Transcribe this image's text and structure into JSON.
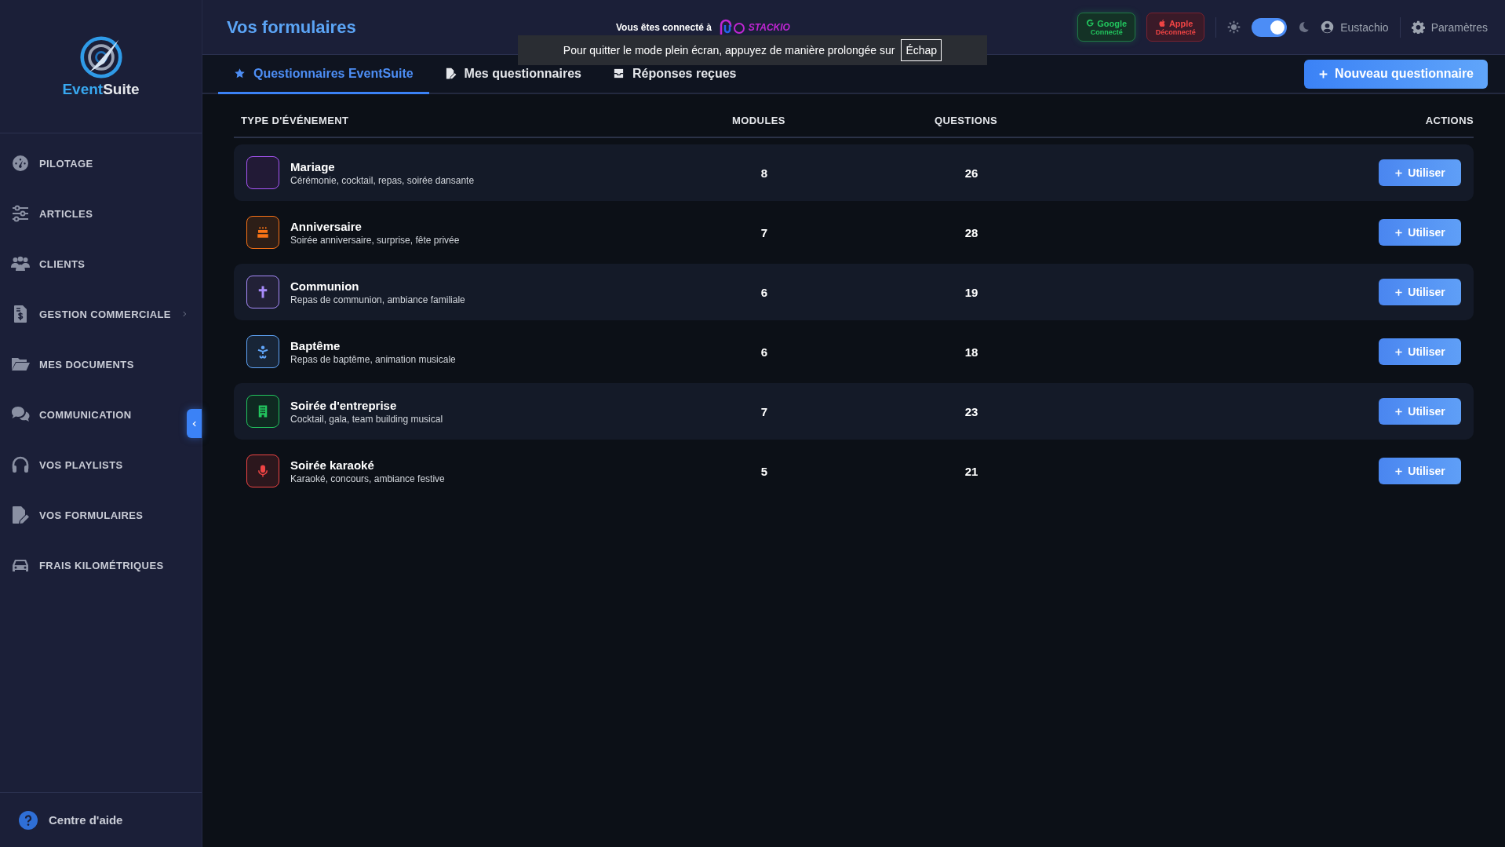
{
  "sidebar": {
    "logo": {
      "first": "Event",
      "second": "Suite"
    },
    "items": [
      {
        "label": "PILOTAGE",
        "kind": "link"
      },
      {
        "label": "ARTICLES",
        "kind": "link"
      },
      {
        "label": "CLIENTS",
        "kind": "link"
      },
      {
        "label": "GESTION COMMERCIALE",
        "kind": "group"
      },
      {
        "label": "MES DOCUMENTS",
        "kind": "link"
      },
      {
        "label": "COMMUNICATION",
        "kind": "link"
      },
      {
        "label": "VOS PLAYLISTS",
        "kind": "link"
      },
      {
        "label": "VOS FORMULAIRES",
        "kind": "link"
      },
      {
        "label": "FRAIS KILOMÉTRIQUES",
        "kind": "link"
      }
    ],
    "help": "Centre d'aide"
  },
  "header": {
    "title": "Vos formulaires",
    "connected_to": "Vous êtes connecté à",
    "partner": "STACKIO",
    "accounts": [
      {
        "name": "Google",
        "status": "Connecté",
        "connected": true
      },
      {
        "name": "Apple",
        "status": "Déconnecté",
        "connected": false
      }
    ],
    "dark_mode": {
      "on": true
    },
    "user": "Eustachio",
    "settings": "Paramètres"
  },
  "toast": {
    "text": "Pour quitter le mode plein écran, appuyez de manière prolongée sur",
    "key": "Échap"
  },
  "tabs": [
    {
      "label": "Questionnaires EventSuite",
      "selected": true
    },
    {
      "label": "Mes questionnaires",
      "selected": false
    },
    {
      "label": "Réponses reçues",
      "selected": false
    }
  ],
  "new_button": "Nouveau questionnaire",
  "table": {
    "columns": [
      "TYPE D'ÉVÉNEMENT",
      "MODULES",
      "QUESTIONS",
      "ACTIONS"
    ],
    "rows": [
      {
        "name": "Mariage",
        "description": "Cérémonie, cocktail, repas, soirée dansante",
        "modules": "8",
        "questions": "26",
        "action": "Utiliser",
        "color": "#a855f7"
      },
      {
        "name": "Anniversaire",
        "description": "Soirée anniversaire, surprise, fête privée",
        "modules": "7",
        "questions": "28",
        "action": "Utiliser",
        "color": "#f97316"
      },
      {
        "name": "Communion",
        "description": "Repas de communion, ambiance familiale",
        "modules": "6",
        "questions": "19",
        "action": "Utiliser",
        "color": "#a78bfa"
      },
      {
        "name": "Baptême",
        "description": "Repas de baptême, animation musicale",
        "modules": "6",
        "questions": "18",
        "action": "Utiliser",
        "color": "#60a5fa"
      },
      {
        "name": "Soirée d'entreprise",
        "description": "Cocktail, gala, team building musical",
        "modules": "7",
        "questions": "23",
        "action": "Utiliser",
        "color": "#22c55e"
      },
      {
        "name": "Soirée karaoké",
        "description": "Karaoké, concours, ambiance festive",
        "modules": "5",
        "questions": "21",
        "action": "Utiliser",
        "color": "#ef4444"
      }
    ]
  }
}
